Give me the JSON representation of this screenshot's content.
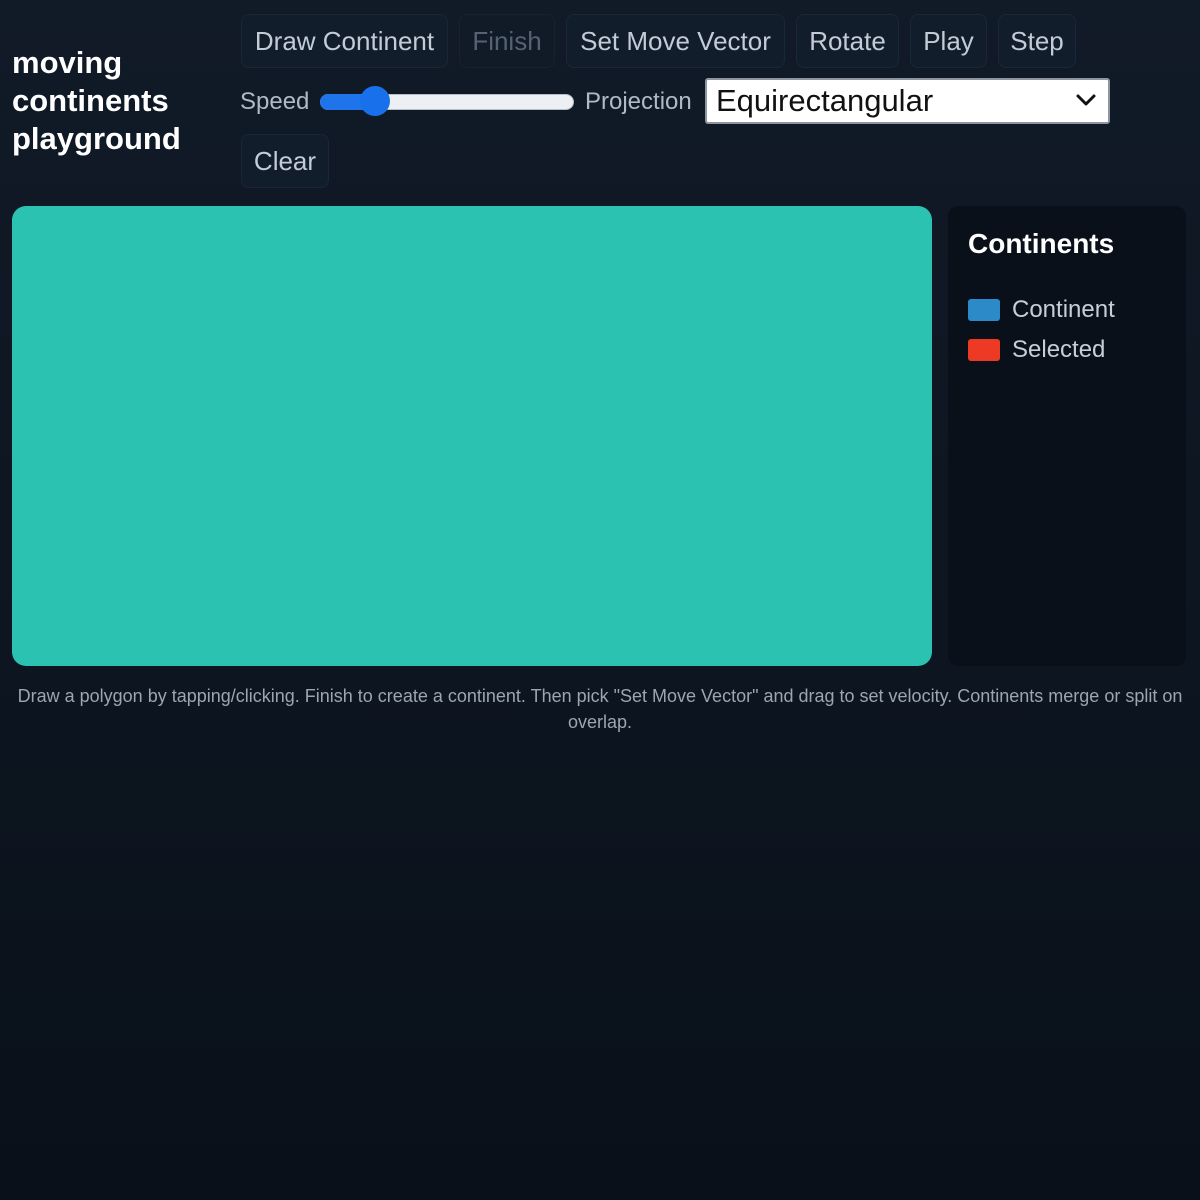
{
  "app": {
    "title": "moving continents playground"
  },
  "toolbar": {
    "buttons": [
      {
        "label": "Draw Continent",
        "enabled": true
      },
      {
        "label": "Finish",
        "enabled": false
      },
      {
        "label": "Set Move Vector",
        "enabled": true
      },
      {
        "label": "Rotate",
        "enabled": true
      },
      {
        "label": "Play",
        "enabled": true
      },
      {
        "label": "Step",
        "enabled": true
      },
      {
        "label": "Clear",
        "enabled": true
      }
    ],
    "speed_label": "Speed",
    "speed_value_fraction": 0.22,
    "projection_label": "Projection",
    "projection_selected": "Equirectangular"
  },
  "canvas": {
    "background_color": "#2bc2b1"
  },
  "panel": {
    "title": "Continents",
    "legend": [
      {
        "label": "Continent",
        "color": "#2c8ac9"
      },
      {
        "label": "Selected",
        "color": "#ec3a24"
      }
    ]
  },
  "hint": "Draw a polygon by tapping/clicking. Finish to create a continent. Then pick \"Set Move Vector\" and drag to set velocity. Continents merge or split on overlap.",
  "colors": {
    "accent": "#1f74ec",
    "background": "#0d1520"
  }
}
